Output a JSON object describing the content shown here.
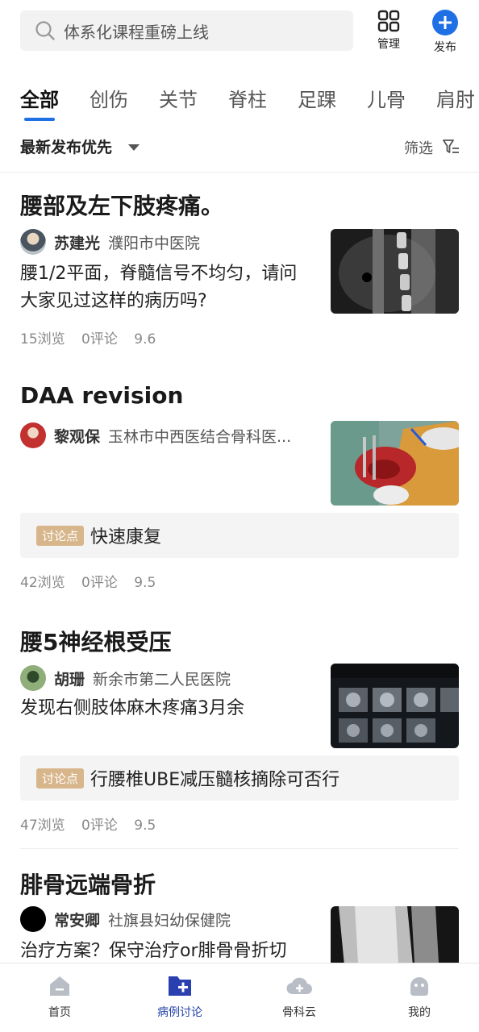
{
  "search": {
    "placeholder": "体系化课程重磅上线"
  },
  "top_actions": {
    "manage": "管理",
    "publish": "发布"
  },
  "tabs": [
    "全部",
    "创伤",
    "关节",
    "脊柱",
    "足踝",
    "儿骨",
    "肩肘"
  ],
  "active_tab": "全部",
  "sort": {
    "label": "最新发布优先",
    "filter": "筛选"
  },
  "posts": [
    {
      "title": "腰部及左下肢疼痛。",
      "author": "苏建光",
      "hospital": "濮阳市中医院",
      "body": "腰1/2平面，脊髓信号不均匀，请问大家见过这样的病历吗?",
      "topic_tag": "",
      "topic": "",
      "views": "15浏览",
      "comments": "0评论",
      "score": "9.6"
    },
    {
      "title": "DAA revision",
      "author": "黎观保",
      "hospital": "玉林市中西医结合骨科医...",
      "body": "",
      "topic_tag": "讨论点",
      "topic": "快速康复",
      "views": "42浏览",
      "comments": "0评论",
      "score": "9.5"
    },
    {
      "title": "腰5神经根受压",
      "author": "胡珊",
      "hospital": "新余市第二人民医院",
      "body": "发现右侧肢体麻木疼痛3月余",
      "topic_tag": "讨论点",
      "topic": "行腰椎UBE减压髓核摘除可否行",
      "views": "47浏览",
      "comments": "0评论",
      "score": "9.5"
    },
    {
      "title": "腓骨远端骨折",
      "author": "常安卿",
      "hospital": "社旗县妇幼保健院",
      "body": "治疗方案？保守治疗or腓骨骨折切",
      "topic_tag": "",
      "topic": "",
      "views": "",
      "comments": "",
      "score": ""
    }
  ],
  "bottom_nav": [
    {
      "label": "首页",
      "icon": "home-icon"
    },
    {
      "label": "病例讨论",
      "icon": "case-discussion-icon"
    },
    {
      "label": "骨科云",
      "icon": "cloud-icon"
    },
    {
      "label": "我的",
      "icon": "profile-icon"
    }
  ],
  "active_nav": "病例讨论",
  "colors": {
    "accent": "#1f6fe5",
    "topic_tag": "#d8b68c",
    "nav_active": "#1f3fa8"
  }
}
